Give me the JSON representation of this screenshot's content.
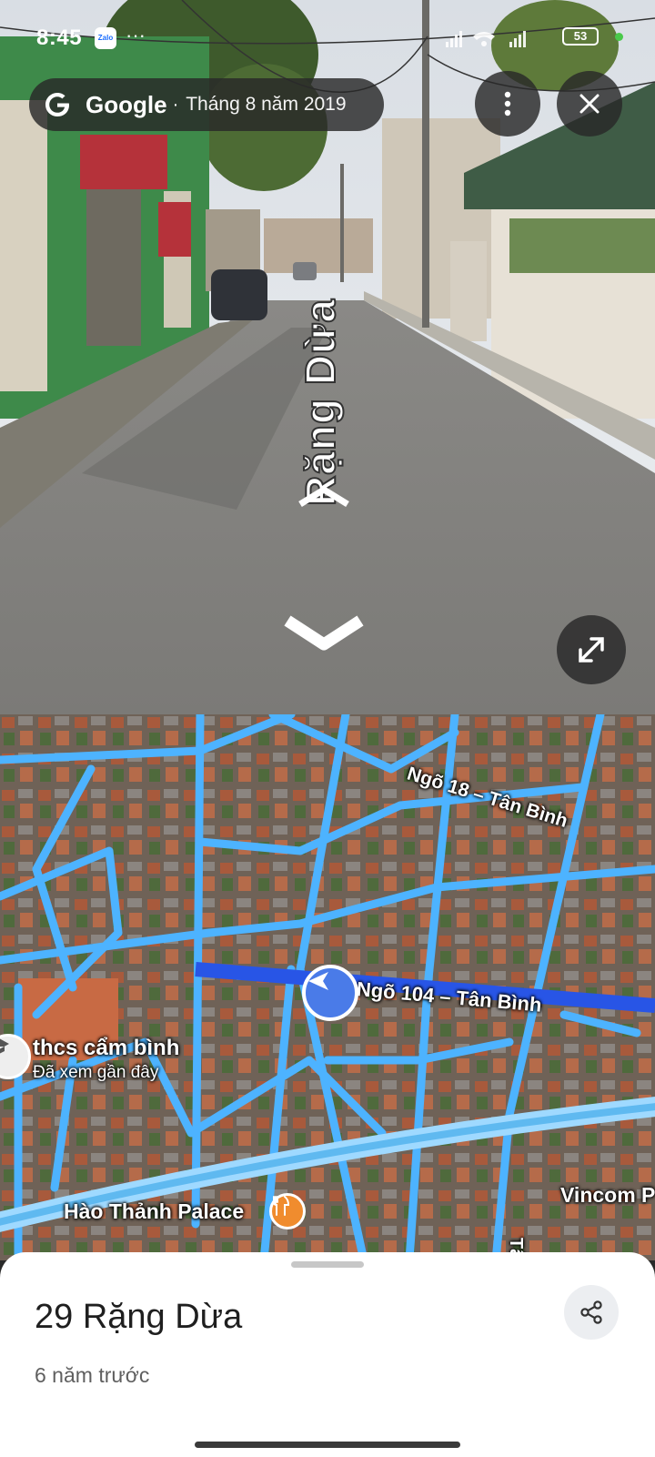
{
  "status_bar": {
    "time": "8:45",
    "zalo_label": "Zalo",
    "more_dots": "···",
    "battery": "53"
  },
  "streetview": {
    "brand": "Google",
    "separator": "·",
    "capture_date": "Tháng 8 năm 2019",
    "road_label": "Rặng Dừa",
    "menu_icon": "more-vert-icon",
    "close_icon": "close-icon",
    "expand_icon": "expand-icon"
  },
  "map": {
    "labels": {
      "ngo18": "Ngõ 18 – Tân Bình",
      "ngo104": "Ngõ 104 – Tân Bình",
      "school": "thcs cẩm bình",
      "school_sub": "Đã xem gần đây",
      "restaurant": "Hào Thảnh Palace",
      "tan_binh": "Tân Bình",
      "vincom": "Vincom P"
    },
    "road_color": "#4db3ff",
    "highlight_color": "#2855e6"
  },
  "place": {
    "title": "29 Rặng Dừa",
    "subtitle": "6 năm trước",
    "share_icon": "share-icon"
  }
}
